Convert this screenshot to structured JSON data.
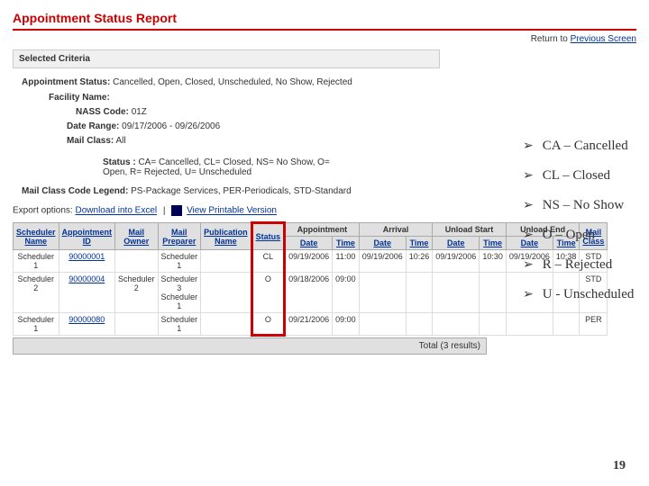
{
  "title": "Appointment Status Report",
  "return_link_prefix": "Return to ",
  "return_link_text": "Previous Screen",
  "sections": {
    "selected_criteria": "Selected Criteria"
  },
  "criteria": {
    "appt_status_lbl": "Appointment Status:",
    "appt_status_val": "Cancelled, Open, Closed, Unscheduled, No Show, Rejected",
    "facility_lbl": "Facility Name:",
    "facility_val": "",
    "nass_lbl": "NASS Code:",
    "nass_val": "01Z",
    "date_lbl": "Date Range:",
    "date_val": "09/17/2006 - 09/26/2006",
    "mail_lbl": "Mail Class:",
    "mail_val": "All",
    "status_lbl": "Status :",
    "status_val": "CA= Cancelled, CL= Closed, NS= No Show, O= Open, R= Rejected, U= Unscheduled",
    "legend_lbl": "Mail Class Code Legend:",
    "legend_val": "PS-Package Services, PER-Periodicals, STD-Standard"
  },
  "export": {
    "label": "Export options:",
    "excel": "Download into Excel",
    "print": "View Printable Version"
  },
  "columns": {
    "sched": "Scheduler Name",
    "appt": "Appointment ID",
    "mo": "Mail Owner",
    "mp": "Mail Preparer",
    "pub": "Publication Name",
    "status": "Status",
    "appt_date": "Appointment",
    "arrival": "Arrival",
    "unload_start": "Unload Start",
    "unload_end": "Unload End",
    "mail_class": "Mail Class",
    "date": "Date",
    "time": "Time"
  },
  "rows": [
    {
      "sched": "Scheduler 1",
      "appt": "90000001",
      "mo": "",
      "mp": "Scheduler 1",
      "pub": "",
      "status": "CL",
      "a_date": "09/19/2006",
      "a_time": "11:00",
      "ar_date": "09/19/2006",
      "ar_time": "10:26",
      "us_date": "09/19/2006",
      "us_time": "10:30",
      "ue_date": "09/19/2006",
      "ue_time": "10:38",
      "mc": "STD"
    },
    {
      "sched": "Scheduler 2",
      "appt": "90000004",
      "mo": "Scheduler 2",
      "mp": "Scheduler 3\nScheduler 1",
      "pub": "",
      "status": "O",
      "a_date": "09/18/2006",
      "a_time": "09:00",
      "ar_date": "",
      "ar_time": "",
      "us_date": "",
      "us_time": "",
      "ue_date": "",
      "ue_time": "",
      "mc": "STD"
    },
    {
      "sched": "Scheduler 1",
      "appt": "90000080",
      "mo": "",
      "mp": "Scheduler 1",
      "pub": "",
      "status": "O",
      "a_date": "09/21/2006",
      "a_time": "09:00",
      "ar_date": "",
      "ar_time": "",
      "us_date": "",
      "us_time": "",
      "ue_date": "",
      "ue_time": "",
      "mc": "PER"
    }
  ],
  "total_label": "Total (3 results)",
  "legend_list": [
    "CA – Cancelled",
    "CL – Closed",
    "NS – No Show",
    "O – Open",
    "R – Rejected",
    "U - Unscheduled"
  ],
  "page_number": "19"
}
